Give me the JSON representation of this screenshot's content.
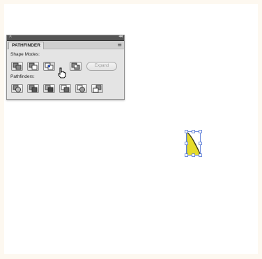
{
  "panel": {
    "title": "PATHFINDER",
    "close_glyph": "×",
    "collapse_glyph": "◂◂",
    "menu_glyph": "≡",
    "shape_modes_label": "Shape Modes:",
    "pathfinders_label": "Pathfinders:",
    "expand_label": "Expand",
    "shape_modes": [
      {
        "name": "unite"
      },
      {
        "name": "minus-front"
      },
      {
        "name": "intersect"
      },
      {
        "name": "exclude"
      }
    ],
    "pathfinders": [
      {
        "name": "divide"
      },
      {
        "name": "trim"
      },
      {
        "name": "merge"
      },
      {
        "name": "crop"
      },
      {
        "name": "outline"
      },
      {
        "name": "minus-back"
      }
    ]
  },
  "colors": {
    "selection": "#4a6fd4",
    "shape_fill": "#e6dc2a",
    "shape_dark": "#3a3a1a"
  },
  "icons": {
    "cursor": "hand-pointer-icon"
  }
}
